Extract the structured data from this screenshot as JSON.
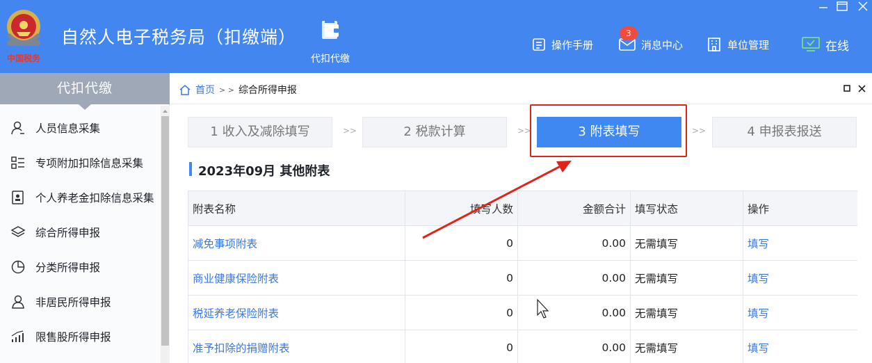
{
  "app": {
    "title": "自然人电子税务局（扣缴端）",
    "emblem_text": "中国税务",
    "module_label": "代扣代缴"
  },
  "toolbar": {
    "manual": "操作手册",
    "messages": "消息中心",
    "message_count": "3",
    "unit_mgmt": "单位管理",
    "online": "在线"
  },
  "sidebar": {
    "header": "代扣代缴",
    "items": [
      {
        "label": "人员信息采集",
        "icon": "person-icon"
      },
      {
        "label": "专项附加扣除信息采集",
        "icon": "list-icon"
      },
      {
        "label": "个人养老金扣除信息采集",
        "icon": "document-icon"
      },
      {
        "label": "综合所得申报",
        "icon": "layers-icon"
      },
      {
        "label": "分类所得申报",
        "icon": "pie-icon"
      },
      {
        "label": "非居民所得申报",
        "icon": "person-outline-icon"
      },
      {
        "label": "限售股所得申报",
        "icon": "bar-chart-icon"
      }
    ]
  },
  "breadcrumb": {
    "home": "首页",
    "separator": "> >",
    "current": "综合所得申报"
  },
  "steps": [
    {
      "label": "1 收入及减除填写",
      "active": false
    },
    {
      "label": "2 税款计算",
      "active": false
    },
    {
      "label": "3 附表填写",
      "active": true
    },
    {
      "label": "4 申报表报送",
      "active": false
    }
  ],
  "step_separator": ">>",
  "section": {
    "title": "2023年09月  其他附表"
  },
  "table": {
    "headers": [
      "附表名称",
      "填写人数",
      "金额合计",
      "填写状态",
      "操作"
    ],
    "rows": [
      {
        "name": "减免事项附表",
        "count": "0",
        "amount": "0.00",
        "status": "无需填写",
        "action": "填写"
      },
      {
        "name": "商业健康保险附表",
        "count": "0",
        "amount": "0.00",
        "status": "无需填写",
        "action": "填写"
      },
      {
        "name": "税延养老保险附表",
        "count": "0",
        "amount": "0.00",
        "status": "无需填写",
        "action": "填写"
      },
      {
        "name": "准予扣除的捐赠附表",
        "count": "0",
        "amount": "0.00",
        "status": "无需填写",
        "action": "填写"
      }
    ]
  },
  "colors": {
    "header_blue": "#4486f0",
    "active_step": "#3f87f1",
    "link": "#3b78e0",
    "annotation_red": "#e2231a",
    "badge_red": "#f04c3e",
    "online_green": "#7be07b"
  }
}
